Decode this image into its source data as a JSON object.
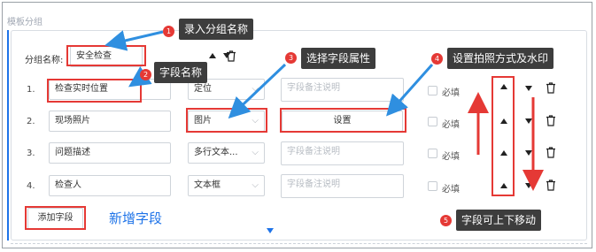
{
  "section": {
    "title": "模板分组"
  },
  "group": {
    "name_label": "分组名称:",
    "name_value": "安全检查"
  },
  "rows": [
    {
      "index": "1.",
      "field_name": "检查实时位置",
      "type": "定位",
      "remark_placeholder": "字段备注说明",
      "required_label": "必填"
    },
    {
      "index": "2.",
      "field_name": "现场照片",
      "type": "图片",
      "settings_label": "设置",
      "required_label": "必填"
    },
    {
      "index": "3.",
      "field_name": "问题描述",
      "type": "多行文本...",
      "remark_placeholder": "字段备注说明",
      "required_label": "必填"
    },
    {
      "index": "4.",
      "field_name": "检查人",
      "type": "文本框",
      "remark_placeholder": "字段备注说明",
      "required_label": "必填"
    }
  ],
  "add_field": {
    "button_label": "添加字段",
    "hint": "新增字段"
  },
  "callouts": [
    {
      "num": "1",
      "text": "录入分组名称"
    },
    {
      "num": "2",
      "text": "字段名称"
    },
    {
      "num": "3",
      "text": "选择字段属性"
    },
    {
      "num": "4",
      "text": "设置拍照方式及水印"
    },
    {
      "num": "5",
      "text": "字段可上下移动"
    }
  ],
  "colors": {
    "accent": "#1e73e8",
    "annotation_red": "#e53935",
    "tooltip_bg": "#3d3d3d",
    "arrow_blue": "#2f8fe0"
  }
}
